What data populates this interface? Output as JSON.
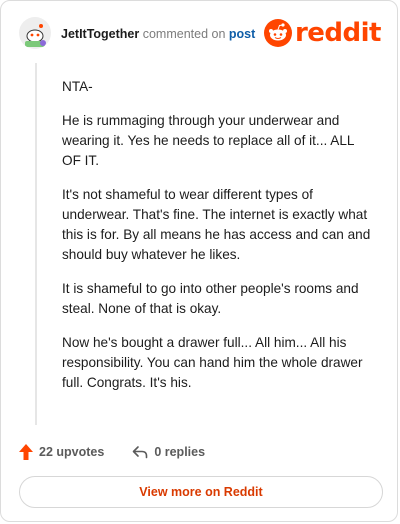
{
  "header": {
    "username": "JetItTogether",
    "action": "commented on",
    "post_link": "post",
    "brand_word": "reddit"
  },
  "comment": {
    "paragraphs": [
      "NTA-",
      "He is rummaging through your underwear and wearing it. Yes he needs to replace all of it... ALL OF IT.",
      "It's not shameful to wear different types of underwear. That's fine. The internet is exactly what this is for. By all means he has access and can and should buy whatever he likes.",
      "It is shameful to go into other people's rooms and steal. None of that is okay.",
      "Now he's bought a drawer full... All him... All his responsibility. You can hand him the whole drawer full. Congrats. It's his."
    ]
  },
  "footer": {
    "upvotes": "22 upvotes",
    "replies": "0 replies",
    "view_more": "View more on Reddit"
  },
  "colors": {
    "brand": "#ff4500",
    "link": "#0f5ea8",
    "button_text": "#d93a00"
  },
  "icons": [
    "avatar-icon",
    "reddit-logo-icon",
    "upvote-arrow-icon",
    "reply-arrow-icon"
  ]
}
